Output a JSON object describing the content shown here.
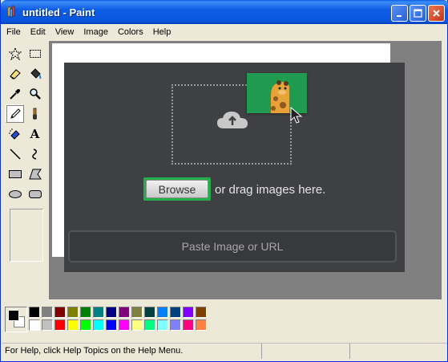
{
  "window": {
    "title": "untitled - Paint"
  },
  "menu": [
    "File",
    "Edit",
    "View",
    "Image",
    "Colors",
    "Help"
  ],
  "tools": [
    {
      "name": "free-form-select-tool",
      "icon": "star-select-icon"
    },
    {
      "name": "select-tool",
      "icon": "rect-select-icon"
    },
    {
      "name": "eraser-tool",
      "icon": "eraser-icon"
    },
    {
      "name": "fill-tool",
      "icon": "paint-bucket-icon"
    },
    {
      "name": "pick-color-tool",
      "icon": "eyedropper-icon"
    },
    {
      "name": "magnifier-tool",
      "icon": "magnifier-icon"
    },
    {
      "name": "pencil-tool",
      "icon": "pencil-icon",
      "selected": true
    },
    {
      "name": "brush-tool",
      "icon": "brush-icon"
    },
    {
      "name": "airbrush-tool",
      "icon": "airbrush-icon"
    },
    {
      "name": "text-tool",
      "icon": "text-icon"
    },
    {
      "name": "line-tool",
      "icon": "line-icon"
    },
    {
      "name": "curve-tool",
      "icon": "curve-icon"
    },
    {
      "name": "rectangle-tool",
      "icon": "rectangle-icon"
    },
    {
      "name": "polygon-tool",
      "icon": "polygon-icon"
    },
    {
      "name": "ellipse-tool",
      "icon": "ellipse-icon"
    },
    {
      "name": "rounded-rectangle-tool",
      "icon": "rounded-rect-icon"
    }
  ],
  "text_tool_glyph": "A",
  "upload_widget": {
    "browse_label": "Browse",
    "drag_text": "or drag images here.",
    "url_placeholder": "Paste Image or URL"
  },
  "palette": {
    "foreground": "#000000",
    "background": "#ffffff",
    "row1": [
      "#000000",
      "#808080",
      "#800000",
      "#808000",
      "#008000",
      "#008080",
      "#000080",
      "#800080",
      "#808040",
      "#004040",
      "#0080ff",
      "#004080",
      "#8000ff",
      "#804000"
    ],
    "row2": [
      "#ffffff",
      "#c0c0c0",
      "#ff0000",
      "#ffff00",
      "#00ff00",
      "#00ffff",
      "#0000ff",
      "#ff00ff",
      "#ffff80",
      "#00ff80",
      "#80ffff",
      "#8080ff",
      "#ff0080",
      "#ff8040"
    ]
  },
  "status": {
    "help_text": "For Help, click Help Topics on the Help Menu."
  },
  "colors": {
    "titlebar": "#0855dd",
    "upload_panel": "#3f4043",
    "browse_highlight": "#23b04a",
    "giraffe_card": "#209a4e"
  }
}
